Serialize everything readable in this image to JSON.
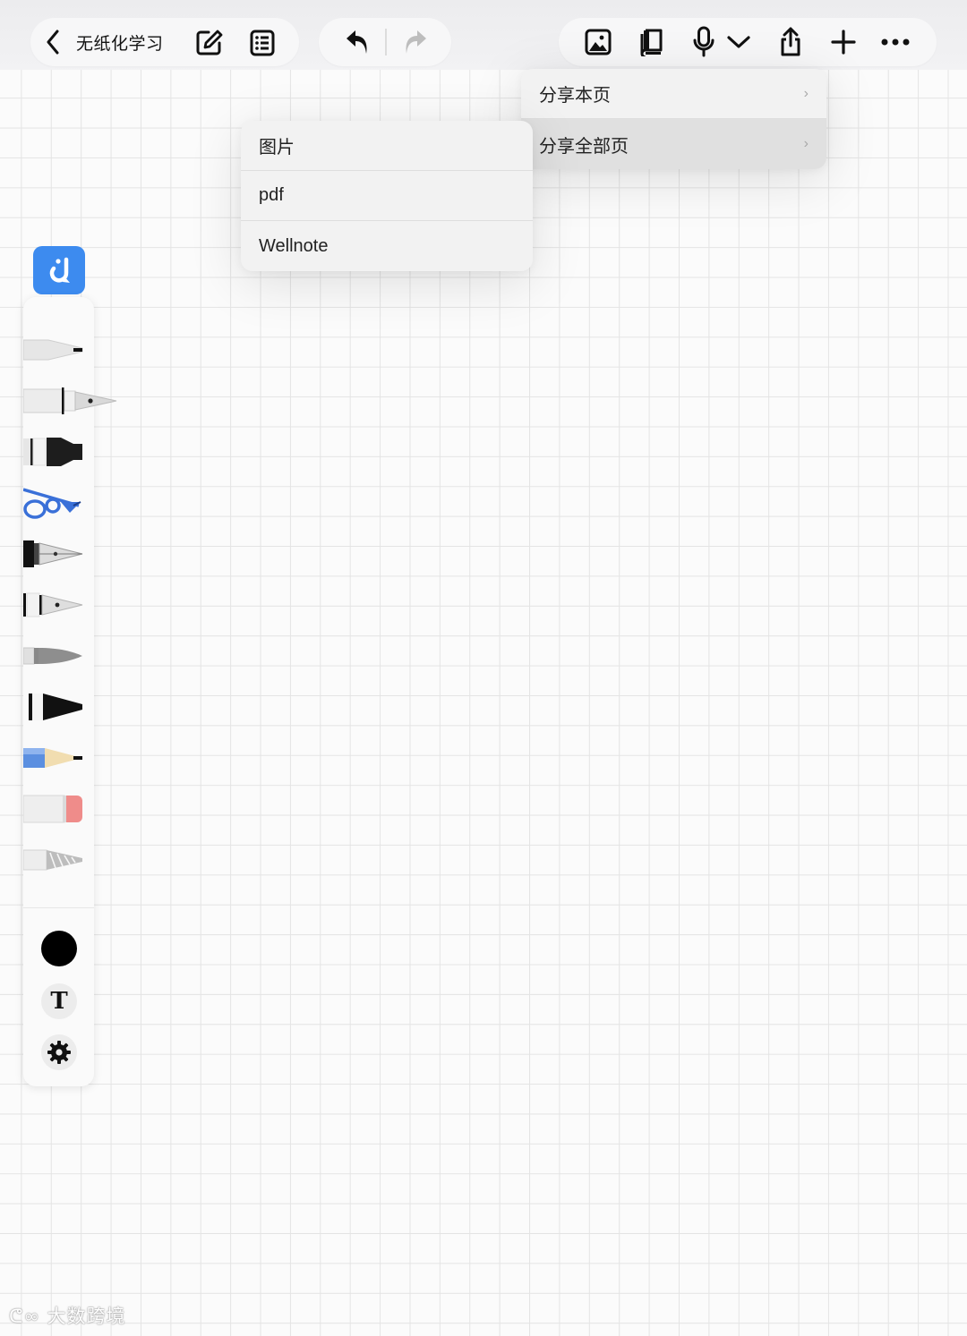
{
  "header": {
    "back_icon": "chevron-left-icon",
    "title": "无纸化学习",
    "edit_icon": "edit-icon",
    "list_icon": "list-icon",
    "undo_icon": "undo-icon",
    "redo_icon": "redo-icon",
    "right_tools": [
      "image-icon",
      "book-icon",
      "microphone-icon",
      "chevron-down-icon",
      "share-icon",
      "plus-icon",
      "more-icon"
    ]
  },
  "share_menu": {
    "items": [
      {
        "label": "分享本页",
        "chevron": "›"
      },
      {
        "label": "分享全部页",
        "chevron": "›"
      }
    ]
  },
  "format_menu": {
    "items": [
      {
        "label": "图片"
      },
      {
        "label": "pdf"
      },
      {
        "label": "Wellnote"
      }
    ]
  },
  "palette": {
    "tools": [
      "pen",
      "fountain-pen",
      "marker",
      "compass",
      "fountain-pen-2",
      "fountain-pen-3",
      "brush",
      "wide-marker",
      "pencil",
      "eraser",
      "lasso"
    ],
    "current_color": "#000000",
    "text_tool_label": "T"
  },
  "colors": {
    "accent": "#3d8bef",
    "grid": "#e4e4e4",
    "background": "#fbfbfb"
  },
  "watermark": {
    "text": "大数跨境"
  }
}
